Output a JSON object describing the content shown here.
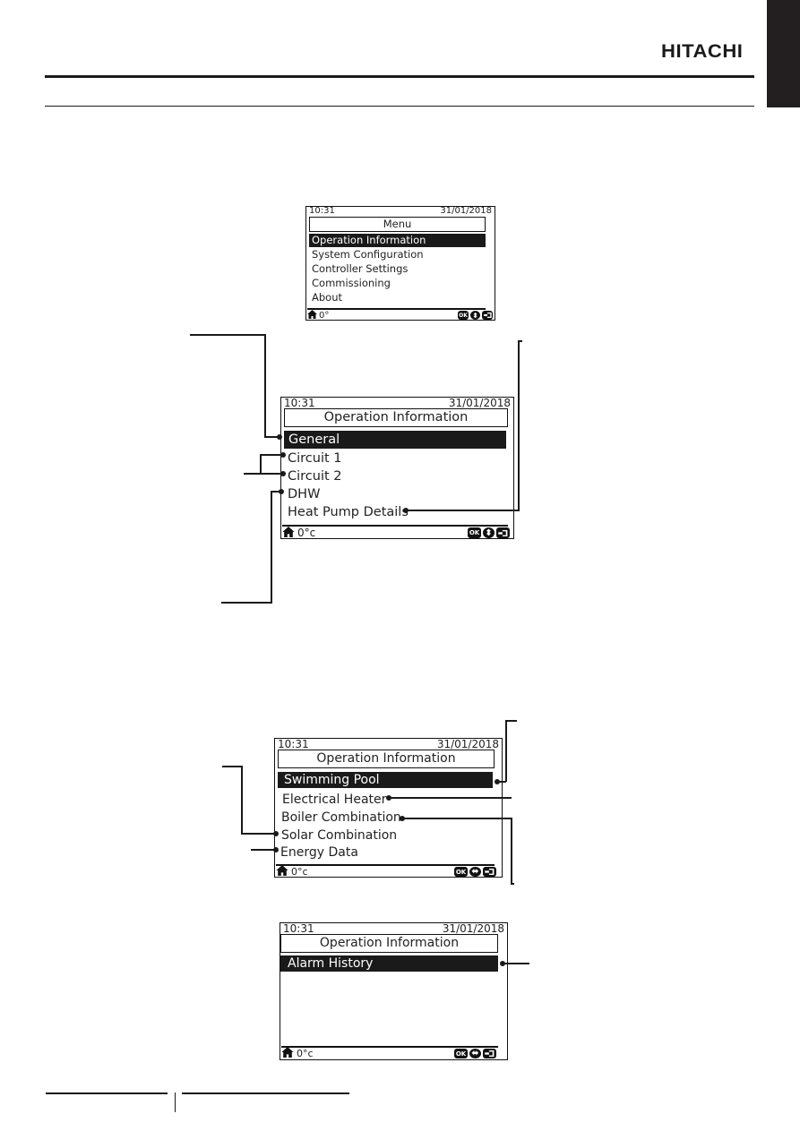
{
  "header": {
    "brand": "HITACHI"
  },
  "screens": [
    {
      "id": "menu",
      "time": "10:31",
      "date": "31/01/2018",
      "title": "Menu",
      "items": [
        {
          "label": "Operation Information",
          "selected": true
        },
        {
          "label": "System Configuration",
          "selected": false
        },
        {
          "label": "Controller Settings",
          "selected": false
        },
        {
          "label": "Commissioning",
          "selected": false
        },
        {
          "label": "About",
          "selected": false
        }
      ],
      "footer": {
        "temp": "0°",
        "icons": [
          "ok-icon",
          "up-down-arrows-icon",
          "back-icon"
        ],
        "ok_label": "OK",
        "nav_glyph": "⬍"
      }
    },
    {
      "id": "operation-info-1",
      "time": "10:31",
      "date": "31/01/2018",
      "title": "Operation Information",
      "items": [
        {
          "label": "General",
          "selected": true
        },
        {
          "label": "Circuit 1",
          "selected": false
        },
        {
          "label": "Circuit 2",
          "selected": false
        },
        {
          "label": "DHW",
          "selected": false
        },
        {
          "label": "Heat Pump Details",
          "selected": false
        }
      ],
      "footer": {
        "temp": "0°c",
        "icons": [
          "ok-icon",
          "up-down-arrows-icon",
          "back-icon"
        ],
        "ok_label": "OK",
        "nav_glyph": "⬍"
      }
    },
    {
      "id": "operation-info-2",
      "time": "10:31",
      "date": "31/01/2018",
      "title": "Operation Information",
      "items": [
        {
          "label": "Swimming Pool",
          "selected": true
        },
        {
          "label": "Electrical Heater",
          "selected": false
        },
        {
          "label": "Boiler Combination",
          "selected": false
        },
        {
          "label": "Solar Combination",
          "selected": false
        },
        {
          "label": "Energy Data",
          "selected": false
        }
      ],
      "footer": {
        "temp": "0°c",
        "icons": [
          "ok-icon",
          "left-right-arrows-icon",
          "back-icon"
        ],
        "ok_label": "OK",
        "nav_glyph": "⬌"
      }
    },
    {
      "id": "operation-info-3",
      "time": "10:31",
      "date": "31/01/2018",
      "title": "Operation Information",
      "items": [
        {
          "label": "Alarm History",
          "selected": true
        }
      ],
      "footer": {
        "temp": "0°c",
        "icons": [
          "ok-icon",
          "left-right-arrows-icon",
          "back-icon"
        ],
        "ok_label": "OK",
        "nav_glyph": "⬌"
      }
    }
  ]
}
